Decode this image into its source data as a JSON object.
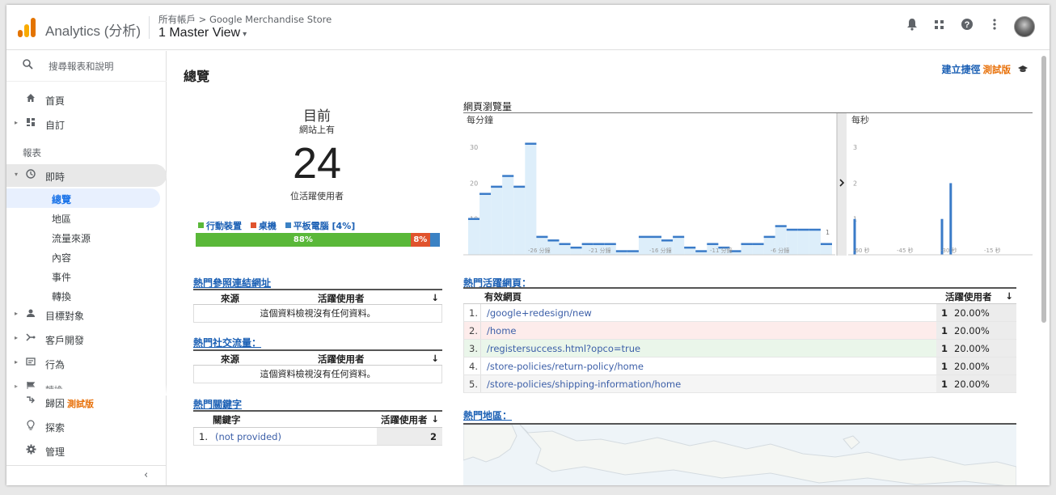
{
  "app": {
    "name": "Analytics (分析)"
  },
  "header": {
    "breadcrumb": "所有帳戶 > Google Merchandise Store",
    "view": "1 Master View",
    "view_caret": "▾"
  },
  "sidebar": {
    "search_label": "搜尋報表和說明",
    "home": "首頁",
    "custom": "自訂",
    "reports_heading": "報表",
    "realtime": "即時",
    "realtime_sub": [
      "總覽",
      "地區",
      "流量來源",
      "內容",
      "事件",
      "轉換"
    ],
    "audience": "目標對象",
    "acquisition": "客戶開發",
    "behavior": "行為",
    "conversions_cut": "轉換",
    "attribution": "歸因",
    "attribution_beta": "測試版",
    "discover": "探索",
    "admin": "管理",
    "collapse_icon": "‹"
  },
  "main": {
    "title": "總覽",
    "shortcut": "建立捷徑",
    "shortcut_beta": "測試版",
    "cap_icon": "graduation-cap-icon"
  },
  "now": {
    "label": "目前",
    "sublabel": "網站上有",
    "count": "24",
    "unit": "位活躍使用者"
  },
  "devices": {
    "legend": [
      {
        "name": "行動裝置",
        "color": "#5ab839"
      },
      {
        "name": "桌機",
        "color": "#e0532d"
      },
      {
        "name": "平板電腦 [4%]",
        "color": "#3b82c4"
      }
    ],
    "mobile_label": "88%",
    "desktop_label": "8%",
    "shares": [
      88,
      8,
      4
    ]
  },
  "referrals": {
    "title": "熱門參照連結網址",
    "col_source": "來源",
    "col_users": "活躍使用者",
    "sort_icon": "↓",
    "empty": "這個資料檢視沒有任何資料。"
  },
  "social": {
    "title": "熱門社交流量：",
    "col_source": "來源",
    "col_users": "活躍使用者",
    "sort_icon": "↓",
    "empty": "這個資料檢視沒有任何資料。"
  },
  "keywords": {
    "title": "熱門關鍵字",
    "col_keyword": "關鍵字",
    "col_users": "活躍使用者",
    "sort_icon": "↓",
    "rows": [
      {
        "idx": "1.",
        "keyword": "(not provided)",
        "users": "2"
      }
    ]
  },
  "active_pages": {
    "title": "熱門活躍網頁：",
    "col_page": "有效網頁",
    "col_users": "活躍使用者",
    "sort_icon": "↓",
    "rows": [
      {
        "idx": "1.",
        "page": "/google+redesign/new",
        "users": "1",
        "pct": "20.00%",
        "bg": "#ffffff"
      },
      {
        "idx": "2.",
        "page": "/home",
        "users": "1",
        "pct": "20.00%",
        "bg": "#fdeceb"
      },
      {
        "idx": "3.",
        "page": "/registersuccess.html?opco=true",
        "users": "1",
        "pct": "20.00%",
        "bg": "#eaf6ea"
      },
      {
        "idx": "4.",
        "page": "/store-policies/return-policy/home",
        "users": "1",
        "pct": "20.00%",
        "bg": "#ffffff"
      },
      {
        "idx": "5.",
        "page": "/store-policies/shipping-information/home",
        "users": "1",
        "pct": "20.00%",
        "bg": "#f5f5f5"
      }
    ]
  },
  "geo": {
    "title": "熱門地區："
  },
  "chart_data": [
    {
      "type": "bar",
      "title": "網頁瀏覽量",
      "panel_label": "每分鐘",
      "y_ticks": [
        "10",
        "20",
        "30"
      ],
      "ylim": [
        0,
        35
      ],
      "x_tick_labels": [
        "-26 分鐘",
        "-21 分鐘",
        "-16 分鐘",
        "-11 分鐘",
        "-6 分鐘"
      ],
      "values": [
        10,
        17,
        19,
        22,
        19,
        31,
        5,
        4,
        3,
        2,
        3,
        3,
        3,
        1,
        1,
        5,
        5,
        4,
        5,
        2,
        1,
        3,
        2,
        1,
        3,
        3,
        5,
        8,
        7,
        7,
        7,
        3
      ],
      "data_labels": [
        "1"
      ]
    },
    {
      "type": "bar",
      "panel_label": "每秒",
      "y_ticks": [
        "1",
        "2",
        "3"
      ],
      "ylim": [
        0,
        3.5
      ],
      "x_tick_labels": [
        "-60 秒",
        "-45 秒",
        "-30 秒",
        "-15 秒"
      ],
      "x": [
        -60,
        -30,
        -27
      ],
      "values": [
        1,
        1,
        2
      ]
    }
  ]
}
